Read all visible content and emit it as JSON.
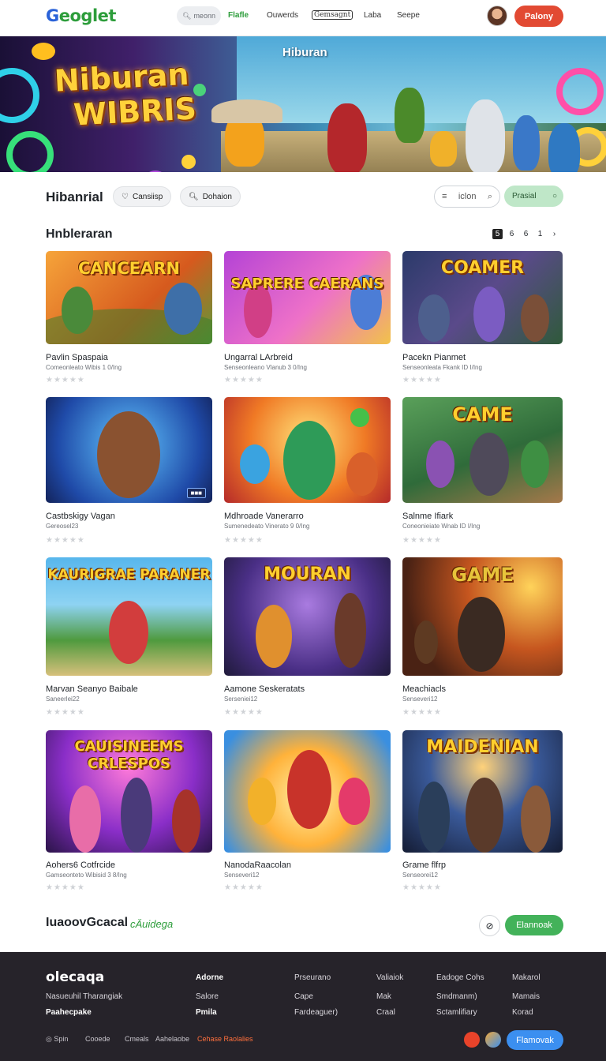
{
  "header": {
    "logo_g": "G",
    "logo_rest": "eoglet",
    "search_placeholder": "meonn",
    "nav": [
      "Flafle",
      "Ouwerds",
      "Gemsagnt",
      "Laba",
      "Seepe"
    ],
    "play_label": "Palony"
  },
  "banner": {
    "title_line1": "Niburan",
    "title_line2": "WIBRIS",
    "subtitle": "Hiburan"
  },
  "filters": {
    "section_title": "Hibanrial",
    "chip1": "Cansiisp",
    "chip2": "Dohaion",
    "search_value": "iclon",
    "green_label": "Prasial"
  },
  "list": {
    "title": "Hnbleraran",
    "pager": [
      "5",
      "6",
      "6",
      "1"
    ]
  },
  "games": [
    {
      "art": "CANCEARN",
      "title": "Pavlin Spaspaia",
      "meta": "Comeonleato Wibis 1 0/Ing"
    },
    {
      "art": "SAPRERE CAERANS",
      "title": "Ungarral LArbreid",
      "meta": "Senseonleano Vlanub 3 0/Ing"
    },
    {
      "art": "COAMER",
      "title": "Pacekn Pianmet",
      "meta": "Senseonleata Fkank ID I/Ing"
    },
    {
      "art": "",
      "title": "Castbskigy Vagan",
      "meta": "Gereosel23"
    },
    {
      "art": "",
      "title": "Mdhroade Vanerarro",
      "meta": "Sumenedeato Vinerato 9 0/Ing"
    },
    {
      "art": "CAME",
      "title": "Salnme Ifiark",
      "meta": "Coneonieiate Wnab ID I/Ing"
    },
    {
      "art": "KAURIGRAE PARANER",
      "title": "Marvan Seanyo Baibale",
      "meta": "Saneerlei22"
    },
    {
      "art": "MOURAN",
      "title": "Aamone Seskeratats",
      "meta": "Serseniei12"
    },
    {
      "art": "GAME",
      "title": "Meachiacls",
      "meta": "Senseveri12"
    },
    {
      "art": "CAUISINEEMS CRLESPOS",
      "title": "Aohers6 Cotfrcide",
      "meta": "Gamseonteto Wibisid 3 8/Ing"
    },
    {
      "art": "",
      "title": "NanodaRaacolan",
      "meta": "Senseveri12"
    },
    {
      "art": "MAIDENIAN",
      "title": "Grame flfrp",
      "meta": "Senseorei12"
    }
  ],
  "stars_glyph": "★★★★★",
  "bottom": {
    "title": "IuaoovGcacal",
    "subtitle": "cÄuidega",
    "circle_glyph": "⊘",
    "button_label": "Elannoak"
  },
  "footer": {
    "logo": "olecaqa",
    "col1": [
      "Nasueuhil Tharangiak",
      "Paahecpake"
    ],
    "col2": [
      "Adorne",
      "Salore",
      "Pmila"
    ],
    "col3": [
      "Prseurano",
      "Cape",
      "Fardeaguer)"
    ],
    "col4": [
      "Valiaiok",
      "Mak",
      "Craal"
    ],
    "col5": [
      "Eadoge Cohs",
      "Smdmanm)",
      "Sctamlifiary"
    ],
    "col6": [
      "Makarol",
      "Mamais",
      "Korad"
    ],
    "bottom_links": [
      "Spin",
      "Cooede",
      "Cmeals",
      "Aahelaobe",
      "Cehase Raolalies"
    ],
    "button_label": "Flamovak"
  }
}
